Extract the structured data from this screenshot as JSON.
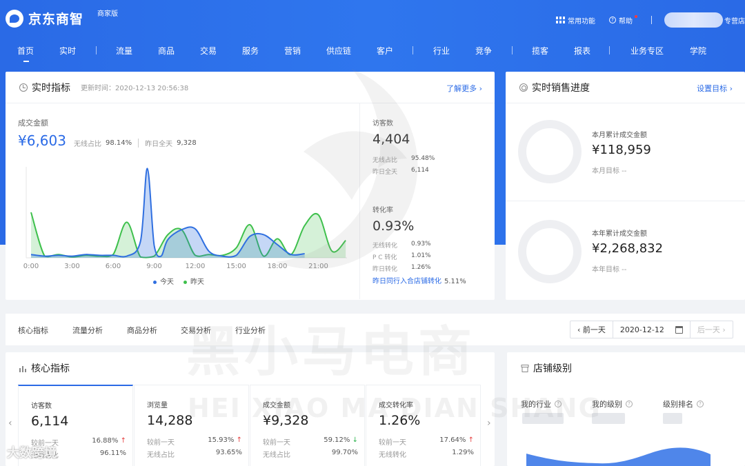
{
  "header": {
    "logo_text": "京东商智",
    "edition": "商家版",
    "common_functions": "常用功能",
    "help": "帮助",
    "shop_suffix": "专营店"
  },
  "nav": [
    "首页",
    "实时",
    "流量",
    "商品",
    "交易",
    "服务",
    "营销",
    "供应链",
    "客户",
    "行业",
    "竞争",
    "揽客",
    "报表",
    "业务专区",
    "学院"
  ],
  "realtime": {
    "title": "实时指标",
    "update_time": "更新时间：2020-12-13 20:56:38",
    "more_link": "了解更多 ›",
    "gmv_label": "成交金额",
    "gmv_value": "¥6,603",
    "wireless_ratio_label": "无线占比",
    "wireless_ratio": "98.14%",
    "yesterday_label": "昨日全天",
    "yesterday_value": "9,328",
    "visitors_label": "访客数",
    "visitors_value": "4,404",
    "visitors_wireless_label": "无线占比",
    "visitors_wireless": "95.48%",
    "visitors_yesterday_label": "昨日全天",
    "visitors_yesterday": "6,114",
    "conv_label": "转化率",
    "conv_value": "0.93%",
    "conv_wireless_label": "无线转化",
    "conv_wireless": "0.93%",
    "conv_pc_label": "P C 转化",
    "conv_pc": "1.01%",
    "conv_yesterday_label": "昨日转化",
    "conv_yesterday": "1.26%",
    "peer_label": "昨日同行入合店铺转化",
    "peer_value": "5.11%"
  },
  "chart_data": {
    "type": "area",
    "x_ticks": [
      "0:00",
      "3:00",
      "6:00",
      "9:00",
      "12:00",
      "15:00",
      "18:00",
      "21:00"
    ],
    "series": [
      {
        "name": "今天",
        "color": "#2f6fe0",
        "x": [
          0,
          1,
          2,
          3,
          4,
          5,
          6,
          7,
          8,
          8.5,
          9,
          9.5,
          10,
          11,
          12,
          13,
          14,
          15,
          16,
          17,
          18,
          19,
          20
        ],
        "values": [
          0.4,
          0.2,
          0.3,
          0.2,
          0.4,
          0.3,
          0.3,
          0.2,
          2.0,
          10.8,
          1.5,
          0.2,
          2.2,
          3.4,
          3.5,
          0.8,
          0.2,
          0.3,
          2.6,
          2.8,
          1.6,
          0.4,
          0.5
        ]
      },
      {
        "name": "昨天",
        "color": "#3ec04c",
        "x": [
          0,
          1,
          2,
          3,
          4,
          5,
          6,
          7,
          8,
          9,
          10,
          11,
          12,
          13,
          14,
          15,
          16,
          17,
          18,
          19,
          20,
          21,
          22,
          23
        ],
        "values": [
          5.5,
          0.2,
          0.4,
          0.1,
          0.3,
          0.2,
          0.4,
          4.3,
          0.1,
          0.2,
          2.8,
          3.4,
          0.3,
          0.4,
          0.3,
          1.2,
          4.0,
          0.2,
          2.3,
          0.4,
          3.9,
          5.2,
          0.8,
          2.1
        ]
      }
    ]
  },
  "sales_progress": {
    "title": "实时销售进度",
    "link": "设置目标 ›",
    "month_label": "本月累计成交金额",
    "month_value": "¥118,959",
    "month_goal": "本月目标 --",
    "year_label": "本年累计成交金额",
    "year_value": "¥2,268,832",
    "year_goal": "本年目标 --"
  },
  "analysis_tabs": [
    "核心指标",
    "流量分析",
    "商品分析",
    "交易分析",
    "行业分析"
  ],
  "date": {
    "prev": "‹ 前一天",
    "current": "2020-12-12",
    "next": "后一天 ›"
  },
  "core": {
    "title": "核心指标",
    "tiles": [
      {
        "label": "访客数",
        "value": "6,114",
        "r1k": "较前一天",
        "r1v": "16.88%",
        "r1dir": "↑",
        "r2k": "无线占比",
        "r2v": "96.11%"
      },
      {
        "label": "浏览量",
        "value": "14,288",
        "r1k": "较前一天",
        "r1v": "15.93%",
        "r1dir": "↑",
        "r2k": "无线占比",
        "r2v": "93.65%"
      },
      {
        "label": "成交金额",
        "value": "¥9,328",
        "r1k": "较前一天",
        "r1v": "59.12%",
        "r1dir": "↓",
        "r2k": "无线占比",
        "r2v": "99.70%"
      },
      {
        "label": "成交转化率",
        "value": "1.26%",
        "r1k": "较前一天",
        "r1v": "17.64%",
        "r1dir": "↑",
        "r2k": "无线转化",
        "r2v": "1.29%"
      }
    ]
  },
  "shop_level": {
    "title": "店铺级别",
    "my_industry": "我的行业",
    "my_level": "我的级别",
    "rank": "级别排名"
  },
  "watermark": {
    "cn": "黑小马电商",
    "en": "HEI XIAO MA DIAN SHANG",
    "corner": "大数跨境"
  }
}
